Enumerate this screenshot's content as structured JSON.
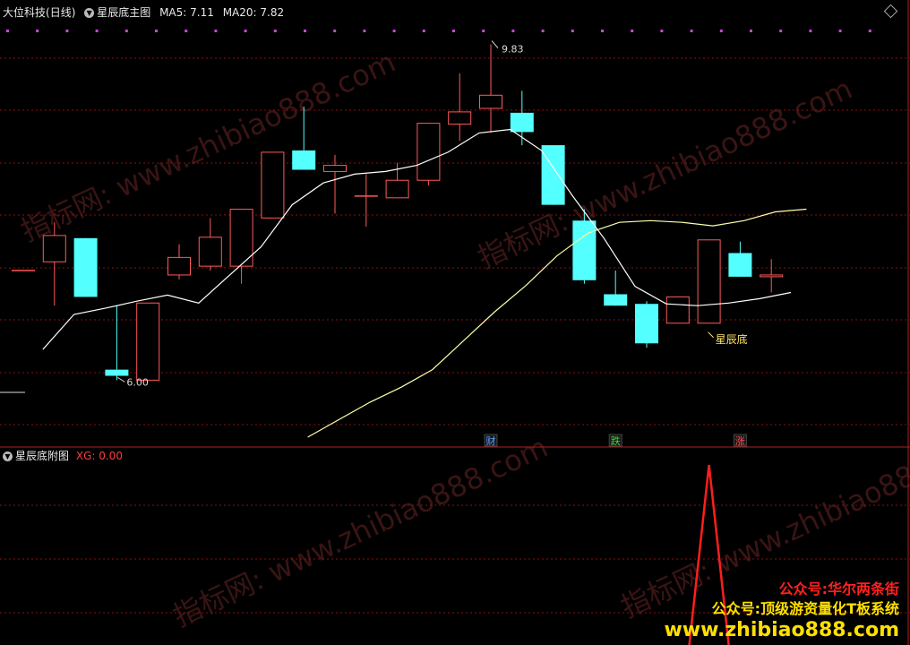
{
  "main_header": {
    "stock_name": "大位科技",
    "period": "(日线)",
    "indicator": "星辰底主图",
    "ma5_label": "MA5:",
    "ma5_value": "7.11",
    "ma20_label": "MA20:",
    "ma20_value": "7.82"
  },
  "sub_header": {
    "indicator": "星辰底附图",
    "xg_label": "XG:",
    "xg_value": "0.00"
  },
  "markers": [
    {
      "label": "财",
      "index": 15,
      "color": "#5aa0ff"
    },
    {
      "label": "跌",
      "index": 19,
      "color": "#33dd33"
    },
    {
      "label": "涨",
      "index": 23,
      "color": "#ff5050"
    }
  ],
  "watermark": {
    "line1": "公众号:华尔两条街",
    "line2": "公众号:顶级游资量化T板系统",
    "line3": "www.zhibiao888.com",
    "diag": "指标网: www.zhibiao888.com"
  },
  "colors": {
    "up": "#ff5a5a",
    "down": "#54ffff",
    "ma5": "#ffffff",
    "ma20": "#ffffa8",
    "grid": "#8a1010",
    "xg": "#ff1e1e"
  },
  "chart_data": {
    "type": "candlestick",
    "price_range": [
      5.35,
      10.05
    ],
    "high_label": "9.83",
    "low_label": "6.00",
    "annotation": "星辰底",
    "candles": [
      {
        "o": 7.25,
        "h": 7.25,
        "l": 7.25,
        "c": 7.25
      },
      {
        "o": 7.35,
        "h": 7.8,
        "l": 6.85,
        "c": 7.65
      },
      {
        "o": 7.62,
        "h": 7.62,
        "l": 6.95,
        "c": 6.95
      },
      {
        "o": 6.12,
        "h": 6.85,
        "l": 6.0,
        "c": 6.05
      },
      {
        "o": 6.0,
        "h": 6.88,
        "l": 6.0,
        "c": 6.88
      },
      {
        "o": 7.2,
        "h": 7.55,
        "l": 7.15,
        "c": 7.4
      },
      {
        "o": 7.3,
        "h": 7.85,
        "l": 7.25,
        "c": 7.63
      },
      {
        "o": 7.3,
        "h": 7.95,
        "l": 7.1,
        "c": 7.95
      },
      {
        "o": 7.85,
        "h": 8.6,
        "l": 7.85,
        "c": 8.6
      },
      {
        "o": 8.62,
        "h": 9.12,
        "l": 8.4,
        "c": 8.4
      },
      {
        "o": 8.38,
        "h": 8.57,
        "l": 7.9,
        "c": 8.45
      },
      {
        "o": 8.1,
        "h": 8.35,
        "l": 7.75,
        "c": 8.1
      },
      {
        "o": 8.08,
        "h": 8.48,
        "l": 8.08,
        "c": 8.28
      },
      {
        "o": 8.28,
        "h": 8.93,
        "l": 8.22,
        "c": 8.93
      },
      {
        "o": 8.92,
        "h": 9.5,
        "l": 8.73,
        "c": 9.06
      },
      {
        "o": 9.1,
        "h": 9.83,
        "l": 8.82,
        "c": 9.25
      },
      {
        "o": 9.05,
        "h": 9.3,
        "l": 8.68,
        "c": 8.83
      },
      {
        "o": 8.68,
        "h": 8.68,
        "l": 8.0,
        "c": 8.0
      },
      {
        "o": 7.82,
        "h": 7.95,
        "l": 7.1,
        "c": 7.14
      },
      {
        "o": 6.98,
        "h": 7.25,
        "l": 6.85,
        "c": 6.85
      },
      {
        "o": 6.87,
        "h": 6.9,
        "l": 6.37,
        "c": 6.42
      },
      {
        "o": 6.65,
        "h": 6.95,
        "l": 6.65,
        "c": 6.95
      },
      {
        "o": 6.65,
        "h": 7.6,
        "l": 6.65,
        "c": 7.6
      },
      {
        "o": 7.45,
        "h": 7.58,
        "l": 7.18,
        "c": 7.18
      },
      {
        "o": 7.18,
        "h": 7.38,
        "l": 7.0,
        "c": 7.2
      }
    ],
    "ma5": [
      [
        1,
        6.35
      ],
      [
        2,
        6.75
      ],
      [
        3,
        6.82
      ],
      [
        4,
        6.9
      ],
      [
        5,
        6.97
      ],
      [
        6,
        6.88
      ],
      [
        7,
        7.2
      ],
      [
        8,
        7.52
      ],
      [
        9,
        8.0
      ],
      [
        10,
        8.25
      ],
      [
        11,
        8.35
      ],
      [
        12,
        8.38
      ],
      [
        13,
        8.45
      ],
      [
        14,
        8.6
      ],
      [
        15,
        8.82
      ],
      [
        16,
        8.86
      ],
      [
        17,
        8.62
      ],
      [
        18,
        8.1
      ],
      [
        19,
        7.62
      ],
      [
        20,
        7.07
      ],
      [
        21,
        6.87
      ],
      [
        22,
        6.85
      ],
      [
        23,
        6.88
      ],
      [
        24,
        6.93
      ],
      [
        25,
        7.0
      ]
    ],
    "ma20": [
      [
        9.5,
        5.35
      ],
      [
        10.5,
        5.55
      ],
      [
        11.5,
        5.75
      ],
      [
        12.5,
        5.92
      ],
      [
        13.5,
        6.12
      ],
      [
        14.5,
        6.45
      ],
      [
        15.5,
        6.78
      ],
      [
        16.5,
        7.08
      ],
      [
        17.5,
        7.42
      ],
      [
        18.5,
        7.68
      ],
      [
        19.5,
        7.8
      ],
      [
        20.5,
        7.82
      ],
      [
        21.5,
        7.8
      ],
      [
        22.5,
        7.76
      ],
      [
        23.5,
        7.82
      ],
      [
        24.5,
        7.92
      ],
      [
        25.5,
        7.95
      ]
    ],
    "xg": {
      "signal_index": 22,
      "value": 1,
      "current": 0
    }
  }
}
